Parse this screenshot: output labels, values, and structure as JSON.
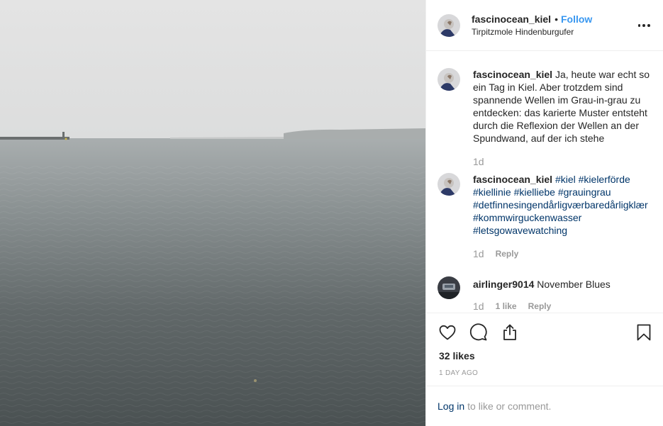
{
  "post": {
    "username": "fascinocean_kiel",
    "dot": "•",
    "follow_label": "Follow",
    "location": "Tirpitzmole Hindenburgufer",
    "more_icon": "more-options-icon"
  },
  "comments": [
    {
      "username": "fascinocean_kiel",
      "text": "Ja, heute war echt so ein Tag in Kiel. Aber trotzdem sind spannende Wellen im Grau-in-grau zu entdecken: das karierte Muster entsteht durch die Reflexion der Wellen an der Spundwand, auf der ich stehe",
      "time": "1d"
    },
    {
      "username": "fascinocean_kiel",
      "hashtags": [
        "#kiel",
        "#kielerförde",
        "#kiellinie",
        "#kielliebe",
        "#grauingrau",
        "#detfinnesingendårligværbaredårligklær",
        "#kommwirguckenwasser",
        "#letsgowavewatching"
      ],
      "time": "1d",
      "reply": "Reply"
    },
    {
      "username": "airlinger9014",
      "text": "November Blues",
      "time": "1d",
      "likes": "1 like",
      "reply": "Reply"
    }
  ],
  "actions": {
    "like_icon": "heart-icon",
    "comment_icon": "comment-icon",
    "share_icon": "share-icon",
    "save_icon": "bookmark-icon"
  },
  "likes": "32 likes",
  "time_ago": "1 day ago",
  "login": {
    "link": "Log in",
    "rest": "to like or comment."
  },
  "colors": {
    "link_blue": "#3897f0",
    "hashtag": "#003569",
    "muted": "#999999",
    "text": "#262626",
    "divider": "#efefef"
  }
}
